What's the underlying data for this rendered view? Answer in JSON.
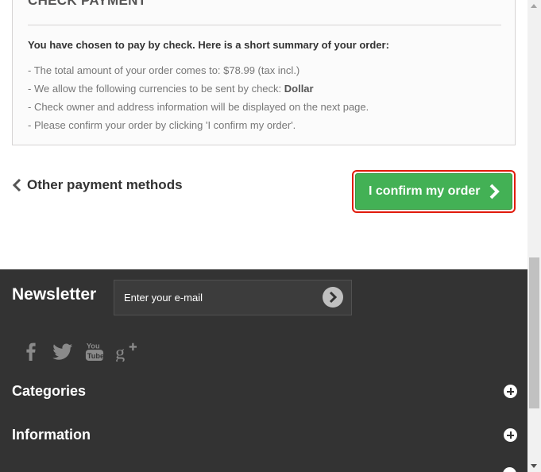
{
  "payment": {
    "title": "CHECK PAYMENT",
    "summary_heading": "You have chosen to pay by check. Here is a short summary of your order:",
    "line1": "- The total amount of your order comes to: $78.99 (tax incl.)",
    "line2_prefix": "- We allow the following currencies to be sent by check: ",
    "line2_currency": "Dollar",
    "line3": "- Check owner and address information will be displayed on the next page.",
    "line4": "- Please confirm your order by clicking 'I confirm my order'."
  },
  "actions": {
    "back_label": "Other payment methods",
    "confirm_label": "I confirm my order"
  },
  "footer": {
    "newsletter_title": "Newsletter",
    "newsletter_placeholder": "Enter your e-mail",
    "social_icons": [
      "facebook-icon",
      "twitter-icon",
      "youtube-icon",
      "google-plus-icon"
    ],
    "sections": [
      "Categories",
      "Information"
    ]
  },
  "colors": {
    "confirm_green": "#43b155",
    "highlight_red": "#e11b0c",
    "footer_bg": "#333333"
  }
}
